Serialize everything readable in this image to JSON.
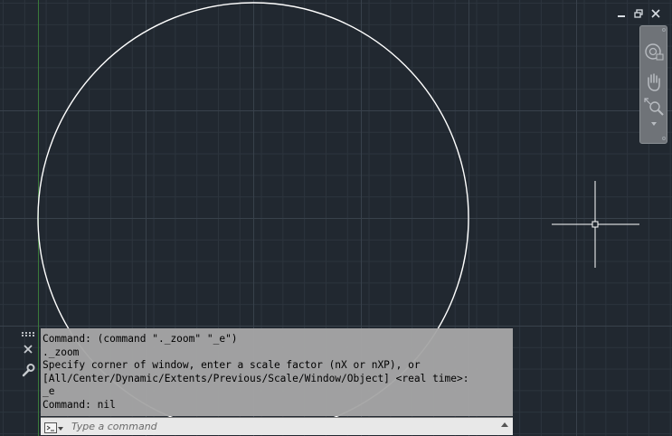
{
  "app": {
    "colors": {
      "background": "#212830",
      "circle": "#ffffff",
      "y_axis": "#3a7a3a",
      "command_panel": "#a5a5a5"
    }
  },
  "viewport_controls": {
    "minimize_icon": "minimize-icon",
    "restore_icon": "restore-icon",
    "close_icon": "close-icon"
  },
  "navigation_bar": {
    "tools": [
      "steering-wheel-icon",
      "pan-hand-icon",
      "zoom-extents-icon"
    ]
  },
  "command_line": {
    "history": [
      "Command: (command \"._zoom\" \"_e\")",
      "._zoom",
      "Specify corner of window, enter a scale factor (nX or nXP), or",
      "[All/Center/Dynamic/Extents/Previous/Scale/Window/Object] <real time>:",
      "_e",
      "Command: nil"
    ],
    "input_value": "",
    "input_placeholder": "Type a command"
  }
}
